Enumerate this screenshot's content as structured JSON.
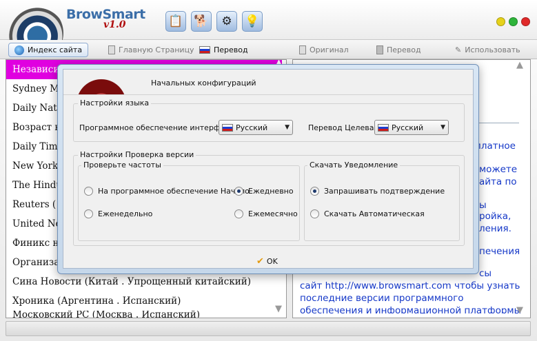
{
  "app": {
    "logo_name": "BrowSmart",
    "logo_version": "v1.0",
    "accent": "#3b6ea8",
    "window_buttons": [
      {
        "name": "minimize-dot",
        "color": "#e6d21a"
      },
      {
        "name": "maximize-dot",
        "color": "#2eb43a"
      },
      {
        "name": "close-dot",
        "color": "#e02a2a"
      }
    ]
  },
  "toolbar": {
    "site_index": "Индекс сайта",
    "home_page": "Главную Страницу",
    "translate_left": "Перевод",
    "original": "Оригинал",
    "translate_right": "Перевод",
    "use": "Использовать"
  },
  "left_list": {
    "items": [
      "Независи",
      "Sydney M",
      "Daily Nat",
      "Возраст н",
      "Daily Tim",
      "New York",
      "The Hindu",
      "Reuters  (",
      "United Ne",
      "Финикс н",
      "Организа",
      "Сина Новости  (Китай . Упрощенный китайский)",
      "Хроника  (Аргентина . Испанский)",
      "Московский РС  (Москва . Испанский)"
    ],
    "selected_index": 0,
    "selected_color": "#e000e0"
  },
  "right_pane": {
    "snippets": [
      "платное",
      "можете",
      "айта по",
      "ы",
      "ройка,",
      "ления.",
      "печения",
      "сы"
    ],
    "line1": "сайт http://www.browsmart.com чтобы узнать",
    "line2": "последние версии программного",
    "line3": "обеспечения и информационной платформы",
    "text_color": "#1538c8"
  },
  "dialog": {
    "title": "Начальных конфигураций",
    "language_group": {
      "legend": "Настройки языка",
      "interface_label": "Программное обеспечение интерфейса",
      "interface_value": "Русский",
      "target_label": "Перевод Целевая",
      "target_value": "Русский"
    },
    "version_group": {
      "legend": "Настройки Проверка версии",
      "frequency": {
        "legend": "Проверьте частоты",
        "options": [
          {
            "label": "На программное обеспечение Начало",
            "checked": false
          },
          {
            "label": "Ежедневно",
            "checked": true
          },
          {
            "label": "Еженедельно",
            "checked": false
          },
          {
            "label": "Ежемесячно",
            "checked": false
          }
        ]
      },
      "download": {
        "legend": "Скачать Уведомление",
        "options": [
          {
            "label": "Запрашивать подтверждение",
            "checked": true
          },
          {
            "label": "Скачать Автоматическая",
            "checked": false
          }
        ]
      }
    },
    "ok_label": "OK"
  }
}
